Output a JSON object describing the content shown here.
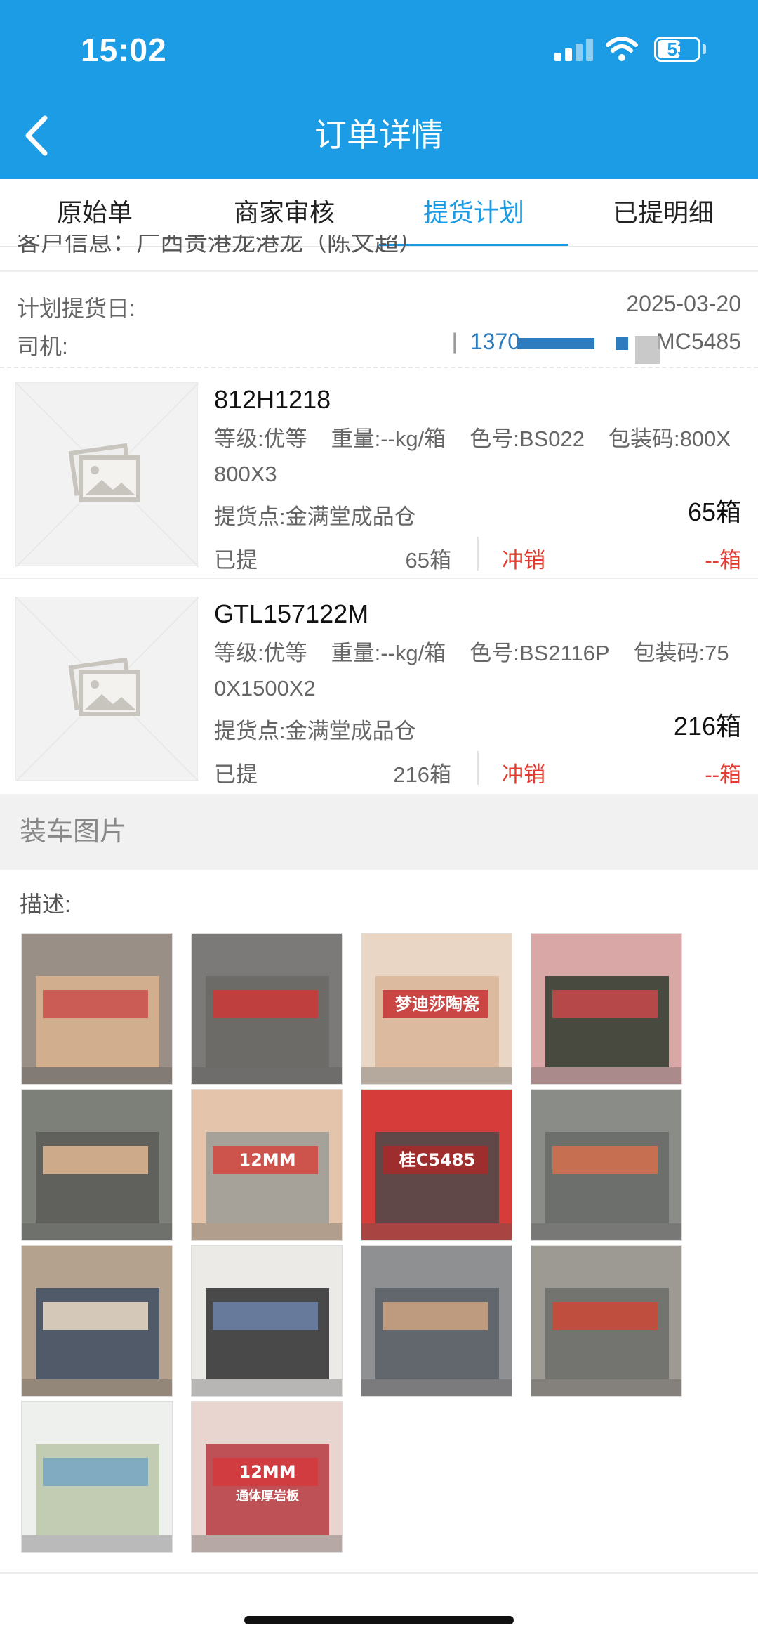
{
  "status_bar": {
    "time": "15:02",
    "battery": "53"
  },
  "header": {
    "title": "订单详情"
  },
  "tabs": [
    {
      "label": "原始单",
      "active": false
    },
    {
      "label": "商家审核",
      "active": false
    },
    {
      "label": "提货计划",
      "active": true
    },
    {
      "label": "已提明细",
      "active": false
    }
  ],
  "cut_line": "客户信息：广西贵港龙港龙（陈文超）",
  "plan": {
    "date_label": "计划提货日:",
    "date_value": "2025-03-20",
    "driver_label": "司机:",
    "driver_phone": "1370",
    "driver_plate": "MC5485"
  },
  "items": [
    {
      "name": "812H1218",
      "grade": "等级:优等",
      "weight": "重量:--kg/箱",
      "color": "色号:BS022",
      "pack": "包装码:800X800X3",
      "point": "提货点:金满堂成品仓",
      "qty": "65箱",
      "picked_label": "已提",
      "picked_value": "65箱",
      "writeoff_label": "冲销",
      "writeoff_value": "--箱"
    },
    {
      "name": "GTL157122M",
      "grade": "等级:优等",
      "weight": "重量:--kg/箱",
      "color": "色号:BS2116P",
      "pack": "包装码:750X1500X2",
      "point": "提货点:金满堂成品仓",
      "qty": "216箱",
      "picked_label": "已提",
      "picked_value": "216箱",
      "writeoff_label": "冲销",
      "writeoff_value": "--箱"
    }
  ],
  "loading": {
    "section_title": "装车图片",
    "desc_label": "描述:",
    "photo_count": 14,
    "photo_text": [
      "梦迪莎陶瓷",
      "12MM",
      "通体厚岩板",
      "桂C5485"
    ]
  },
  "colors": {
    "accent": "#1b9ce5",
    "writeoff": "#e23a2e",
    "phone": "#2d7cc0"
  }
}
